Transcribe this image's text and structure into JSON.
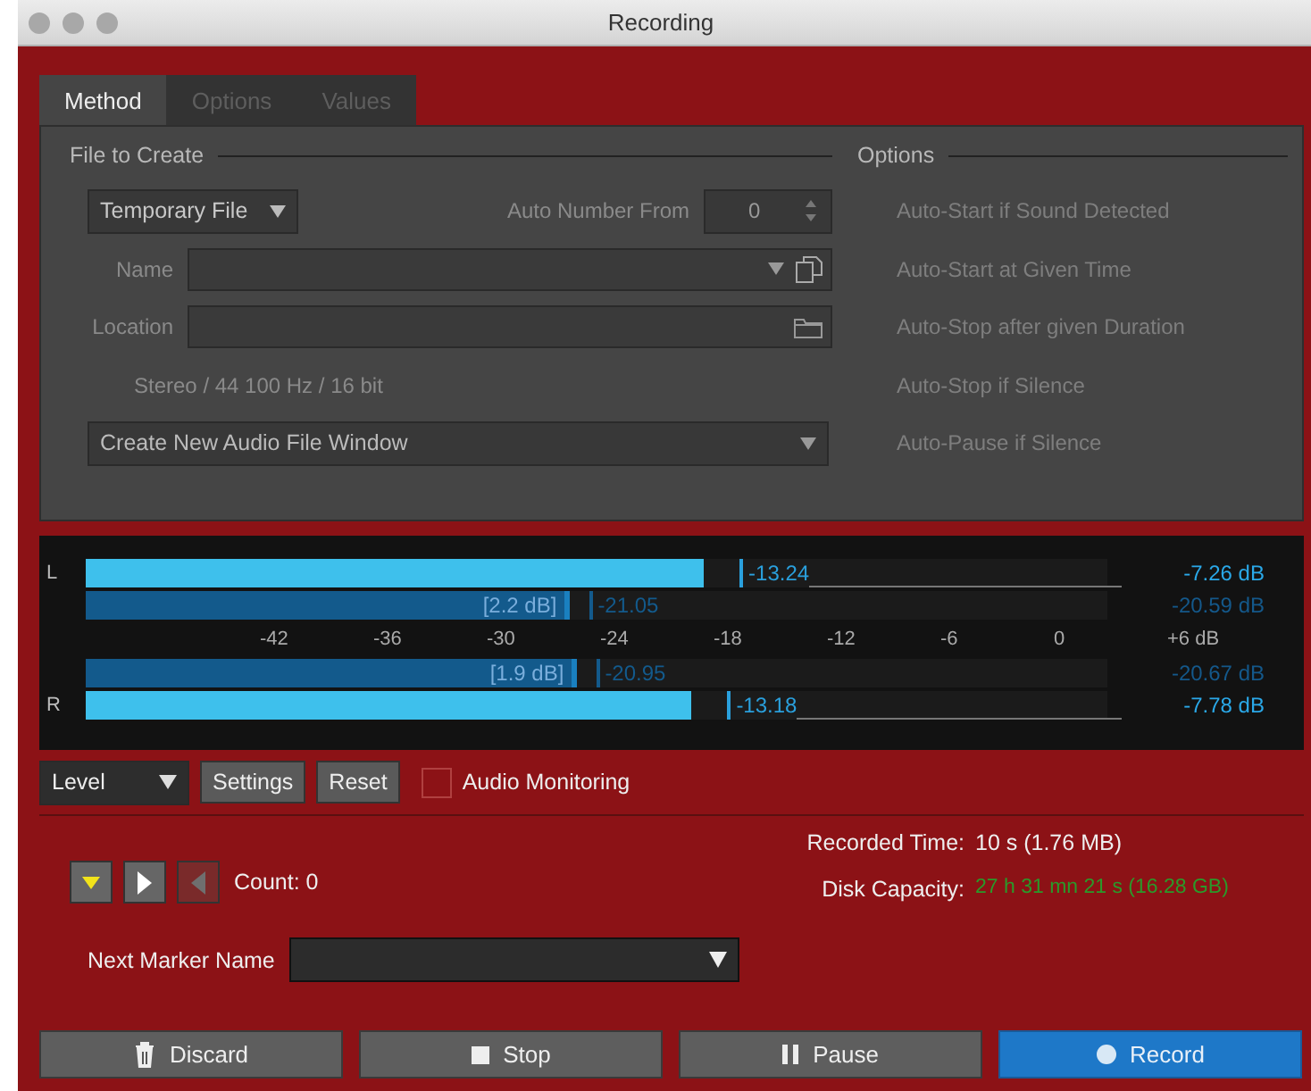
{
  "window": {
    "title": "Recording"
  },
  "tabs": [
    {
      "label": "Method",
      "selected": true
    },
    {
      "label": "Options",
      "selected": false
    },
    {
      "label": "Values",
      "selected": false
    }
  ],
  "file_to_create": {
    "heading": "File to Create",
    "file_type": "Temporary File",
    "auto_number_label": "Auto Number From",
    "auto_number_value": "0",
    "name_label": "Name",
    "location_label": "Location",
    "format": "Stereo / 44 100 Hz / 16 bit",
    "destination": "Create New Audio File Window"
  },
  "options": {
    "heading": "Options",
    "items": [
      "Auto-Start if Sound Detected",
      "Auto-Start at Given Time",
      "Auto-Stop after given Duration",
      "Auto-Stop if Silence",
      "Auto-Pause if Silence"
    ]
  },
  "meter": {
    "rows": [
      {
        "kind": "peak",
        "channel": "L",
        "level": 0.605,
        "marker": "-13.24",
        "reading": "-7.26 dB"
      },
      {
        "kind": "rms",
        "level": 0.468,
        "inner": "[2.2 dB]",
        "marker": "-21.05",
        "reading": "-20.59 dB"
      },
      {
        "kind": "scale",
        "ticks": [
          "-42",
          "-36",
          "-30",
          "-24",
          "-18",
          "-12",
          "-6",
          "0",
          "+6 dB"
        ]
      },
      {
        "kind": "rms",
        "level": 0.475,
        "inner": "[1.9 dB]",
        "marker": "-20.95",
        "reading": "-20.67 dB"
      },
      {
        "kind": "peak",
        "channel": "R",
        "level": 0.593,
        "marker": "-13.18",
        "reading": "-7.78 dB"
      }
    ]
  },
  "meter_controls": {
    "mode": "Level",
    "buttons": [
      "Settings",
      "Reset"
    ],
    "monitoring": {
      "label": "Audio Monitoring",
      "checked": false
    }
  },
  "markers": {
    "buttons": [
      {
        "kind": "down",
        "disabled": false
      },
      {
        "kind": "right",
        "disabled": false
      },
      {
        "kind": "left",
        "disabled": true
      }
    ],
    "count": "Count: 0",
    "next_label": "Next Marker Name"
  },
  "status": [
    {
      "label": "Recorded Time:",
      "value": "10 s (1.76 MB)",
      "kind": "normal"
    },
    {
      "label": "Disk Capacity:",
      "value": "27 h 31 mn 21 s (16.28 GB)",
      "kind": "good"
    }
  ],
  "actions": [
    {
      "label": "Discard",
      "kind": "trash",
      "primary": false
    },
    {
      "label": "Stop",
      "kind": "stop",
      "primary": false
    },
    {
      "label": "Pause",
      "kind": "pause",
      "primary": false
    },
    {
      "label": "Record",
      "kind": "record",
      "primary": true
    }
  ]
}
